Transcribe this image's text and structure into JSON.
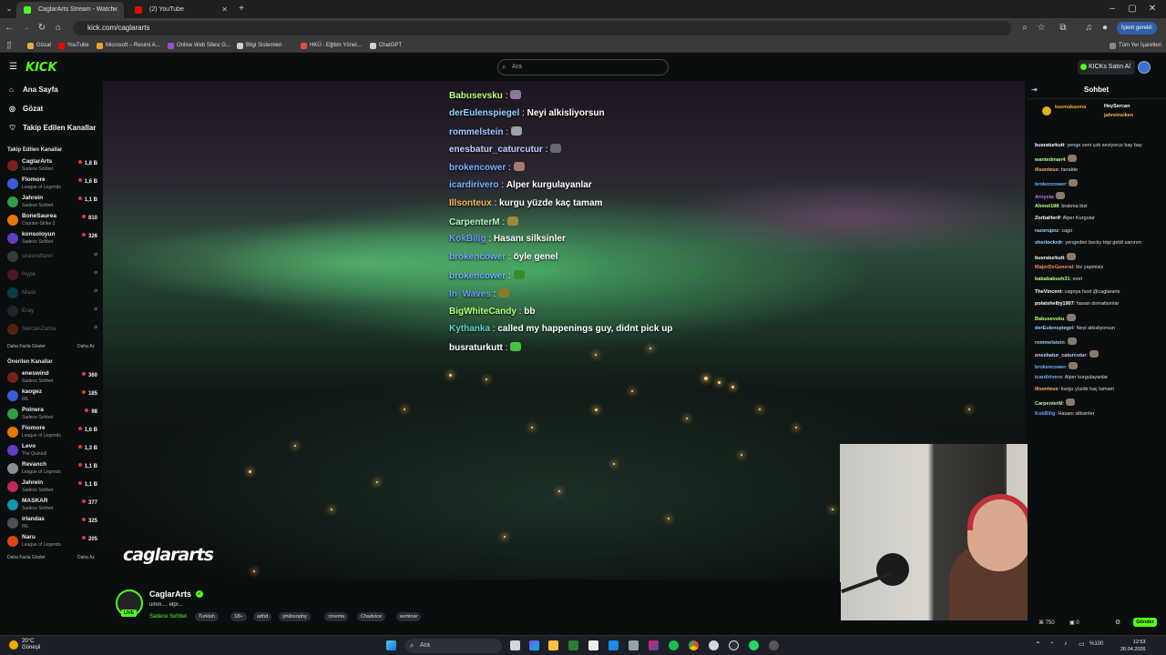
{
  "browser": {
    "tabs": [
      {
        "title": "CaglarArts Stream - Watch",
        "active": true
      },
      {
        "title": "(2) YouTube",
        "active": false
      }
    ],
    "url": "kick.com/caglararts",
    "profile_button": "İşlem gerekli",
    "bookmarks": [
      "Gözat",
      "YouTube",
      "Microsoft – Resimi A...",
      "Online Web Sitesi G...",
      "Bilgi Sistemleri",
      "HKÜ - Eğitim Yönet...",
      "ChatGPT"
    ],
    "all_bookmarks": "Tüm Yer İşaretleri"
  },
  "kick": {
    "logo": "KICK",
    "search_placeholder": "Ara",
    "buy_kicks": "KICKs Satın Al"
  },
  "sidebar": {
    "nav": [
      {
        "label": "Ana Sayfa",
        "icon": "home-icon"
      },
      {
        "label": "Gözat",
        "icon": "compass-icon"
      },
      {
        "label": "Takip Edilen Kanallar",
        "icon": "heart-icon"
      }
    ],
    "followed_heading": "Takip Edilen Kanallar",
    "followed": [
      {
        "name": "CaglarArts",
        "category": "Sadece Sohbet",
        "viewers": "1,8 B"
      },
      {
        "name": "Flomore",
        "category": "League of Legends",
        "viewers": "1,6 B"
      },
      {
        "name": "Jahrein",
        "category": "Sadece Sohbet",
        "viewers": "1,1 B"
      },
      {
        "name": "BoneSaurea",
        "category": "Counter-Strike 2",
        "viewers": "810"
      },
      {
        "name": "konsoloyun",
        "category": "Sadece Sohbet",
        "viewers": "326"
      },
      {
        "name": "sirauraflann",
        "category": "",
        "viewers": ""
      },
      {
        "name": "Hype",
        "category": "",
        "viewers": ""
      },
      {
        "name": "Mask",
        "category": "",
        "viewers": ""
      },
      {
        "name": "Eray",
        "category": "",
        "viewers": ""
      },
      {
        "name": "SercanZuma",
        "category": "",
        "viewers": ""
      }
    ],
    "show_more": "Daha Fazla Göster",
    "show_less": "Daha Az",
    "recommended_heading": "Önerilen Kanallar",
    "recommended": [
      {
        "name": "eneswind",
        "category": "Sadece Sohbet",
        "viewers": "360"
      },
      {
        "name": "kaogez",
        "category": "IRL",
        "viewers": "185"
      },
      {
        "name": "Polnera",
        "category": "Sadece Sohbet",
        "viewers": "98"
      },
      {
        "name": "Flomore",
        "category": "League of Legends",
        "viewers": "1,6 B"
      },
      {
        "name": "Levo",
        "category": "The Quintall",
        "viewers": "1,3 B"
      },
      {
        "name": "Revanch",
        "category": "League of Legends",
        "viewers": "1,1 B"
      },
      {
        "name": "Jahrein",
        "category": "Sadece Sohbet",
        "viewers": "1,1 B"
      },
      {
        "name": "MASKAR",
        "category": "Sadece Sohbet",
        "viewers": "377"
      },
      {
        "name": "irlandas",
        "category": "IRL",
        "viewers": "325"
      },
      {
        "name": "Naru",
        "category": "League of Legends",
        "viewers": "205"
      }
    ]
  },
  "overlay_chat": [
    {
      "user": "Babusevsku",
      "color": "#b6ff7a",
      "text": "",
      "emote": "#8a7a9a"
    },
    {
      "user": "derEulenspiegel",
      "color": "#8fd8ff",
      "text": "Neyi alkisliyorsun",
      "emote": ""
    },
    {
      "user": "rommelstein",
      "color": "#a0c8ff",
      "text": "",
      "emote": "#9aa0b0"
    },
    {
      "user": "enesbatur_caturcutur",
      "color": "#c2d0ff",
      "text": "",
      "emote": "#667"
    },
    {
      "user": "brokencower",
      "color": "#6fb3ff",
      "text": "",
      "emote": "#a87a6a"
    },
    {
      "user": "icardirivero",
      "color": "#6fb3ff",
      "text": "Alper kurgulayanlar",
      "emote": ""
    },
    {
      "user": "Illsonteux",
      "color": "#ffb35c",
      "text": "kurgu yüzde kaç tamam",
      "emote": ""
    },
    {
      "user": "CarpenterM",
      "color": "#b9f0b9",
      "text": "",
      "emote": "#9a8a3a"
    },
    {
      "user": "KokBilig",
      "color": "#6e9cff",
      "text": "Hasanı silksinler",
      "emote": ""
    },
    {
      "user": "brokencower",
      "color": "#6fb3ff",
      "text": "öyle genel",
      "emote": ""
    },
    {
      "user": "brokencower",
      "color": "#6fb3ff",
      "text": "",
      "emote": "#3a8a2a"
    },
    {
      "user": "In_Waves",
      "color": "#6e9cff",
      "text": "",
      "emote": "#8a7a2a"
    },
    {
      "user": "BigWhiteCandy",
      "color": "#b6ff7a",
      "text": "bb",
      "emote": ""
    },
    {
      "user": "Kythanka",
      "color": "#5fd0d0",
      "text": "called my happenings guy, didnt pick up",
      "emote": ""
    },
    {
      "user": "busraturkutt",
      "color": "#ffffff",
      "text": "",
      "emote": "#44c244"
    }
  ],
  "watermark": "caglararts",
  "stream": {
    "streamer": "CaglarArts",
    "title": "umm.... elpr...",
    "category": "Sadece Sohbet",
    "live": "LIVE",
    "tags": [
      "Turkish",
      "18+",
      "adhd",
      "philosophy",
      "cinema",
      "Chadvice",
      "seminar"
    ]
  },
  "chat": {
    "title": "Sohbet",
    "top_gifters": [
      {
        "name": "kasmakasma",
        "count": "1"
      },
      {
        "name": "HeySercan",
        "count": "1"
      },
      {
        "name": "jahreinsiken",
        "count": "1"
      }
    ],
    "messages": [
      {
        "user": "busraturkutt",
        "color": "#ffffff",
        "text": "yenge seni çok seviyoruz bay bay"
      },
      {
        "user": "wantedman4",
        "color": "#b6ff7a",
        "text": ""
      },
      {
        "user": "illsonteux",
        "color": "#ffb35c",
        "text": "heralde"
      },
      {
        "user": "brokencower",
        "color": "#6fb3ff",
        "text": ""
      },
      {
        "user": "Arnyxia",
        "color": "#d36bff",
        "text": ""
      },
      {
        "user": "Ahmet188",
        "color": "#b6ff7a",
        "text": "brakma bizi"
      },
      {
        "user": "ZorbaHerif",
        "color": "#ffffff",
        "text": "Alper Kurgular"
      },
      {
        "user": "razorupnz",
        "color": "#8fd8ff",
        "text": "cago"
      },
      {
        "user": "sherlockrdr",
        "color": "#8fd8ff",
        "text": "yengeden becky tripi geldi sanırım"
      },
      {
        "user": "busraturkutt",
        "color": "#ffffff",
        "text": ""
      },
      {
        "user": "MajorDeGeneral",
        "color": "#ff8a5c",
        "text": "biz yapmisiz"
      },
      {
        "user": "babababush31",
        "color": "#b6ff7a",
        "text": "evet"
      },
      {
        "user": "TheVincent",
        "color": "#ffffff",
        "text": "cagoya host @caglararts"
      },
      {
        "user": "polatshelby1907",
        "color": "#ffffff",
        "text": "hasan domaltsınlar"
      },
      {
        "user": "Babusevsku",
        "color": "#b6ff7a",
        "text": ""
      },
      {
        "user": "derEulenspiegel",
        "color": "#8fd8ff",
        "text": "Neyi alkisliyorsun"
      },
      {
        "user": "rommelstein",
        "color": "#a0c8ff",
        "text": ""
      },
      {
        "user": "enesbatur_caturcutur",
        "color": "#c2d0ff",
        "text": ""
      },
      {
        "user": "brokencower",
        "color": "#6fb3ff",
        "text": ""
      },
      {
        "user": "icardirivero",
        "color": "#6fb3ff",
        "text": "Alper kurgulayanlar"
      },
      {
        "user": "illsonteux",
        "color": "#ffb35c",
        "text": "kurgu yüzde kaç tamam"
      },
      {
        "user": "CarpenterM",
        "color": "#b9f0b9",
        "text": ""
      },
      {
        "user": "KokBilig",
        "color": "#6e9cff",
        "text": "Hasanı silksinler"
      }
    ],
    "viewer_count": "750",
    "points": "0",
    "send": "Gönder"
  },
  "taskbar": {
    "weather_temp": "20°C",
    "weather_desc": "Güneşli",
    "search": "Ara",
    "time": "12:53",
    "date": "26.04.2026"
  }
}
